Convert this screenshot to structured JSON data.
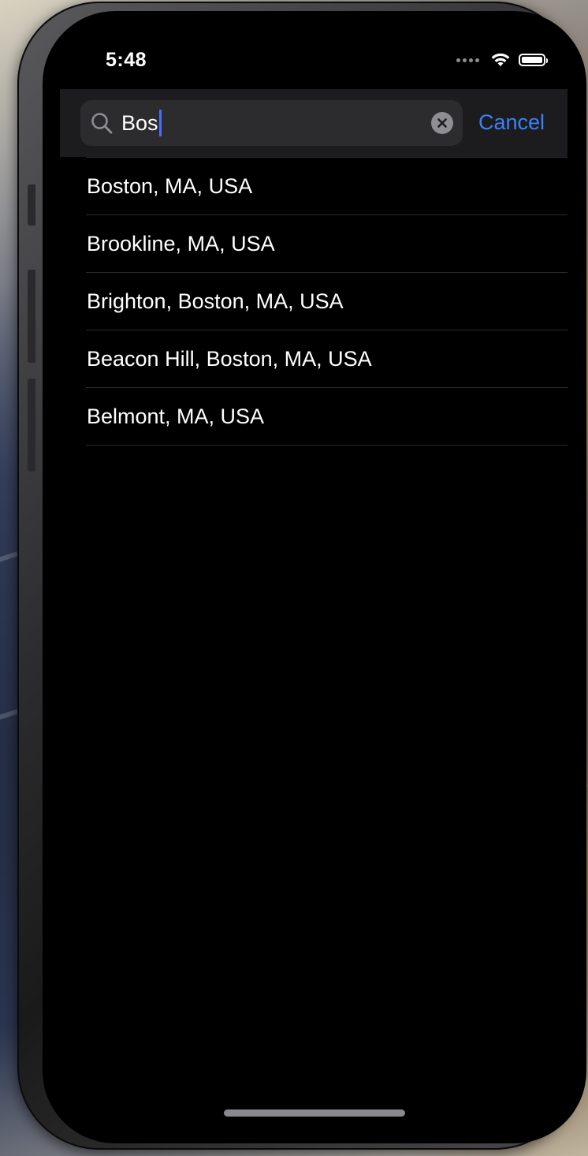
{
  "status_bar": {
    "time": "5:48",
    "signal_icon": "signal-dots-icon",
    "wifi_icon": "wifi-icon",
    "battery_icon": "battery-icon",
    "battery_level": 1.0
  },
  "search": {
    "query": "Bos",
    "search_icon": "search-icon",
    "clear_icon": "clear-icon",
    "cancel_label": "Cancel"
  },
  "results": [
    {
      "label": "Boston, MA, USA"
    },
    {
      "label": "Brookline, MA, USA"
    },
    {
      "label": "Brighton, Boston, MA, USA"
    },
    {
      "label": "Beacon Hill, Boston, MA, USA"
    },
    {
      "label": "Belmont, MA, USA"
    }
  ],
  "colors": {
    "accent": "#3b82f6",
    "caret": "#4a6cf7",
    "background": "#000000",
    "search_bar_bg": "#1c1c1e",
    "search_field_bg": "#2c2c2e",
    "separator": "#2a2a2c"
  }
}
